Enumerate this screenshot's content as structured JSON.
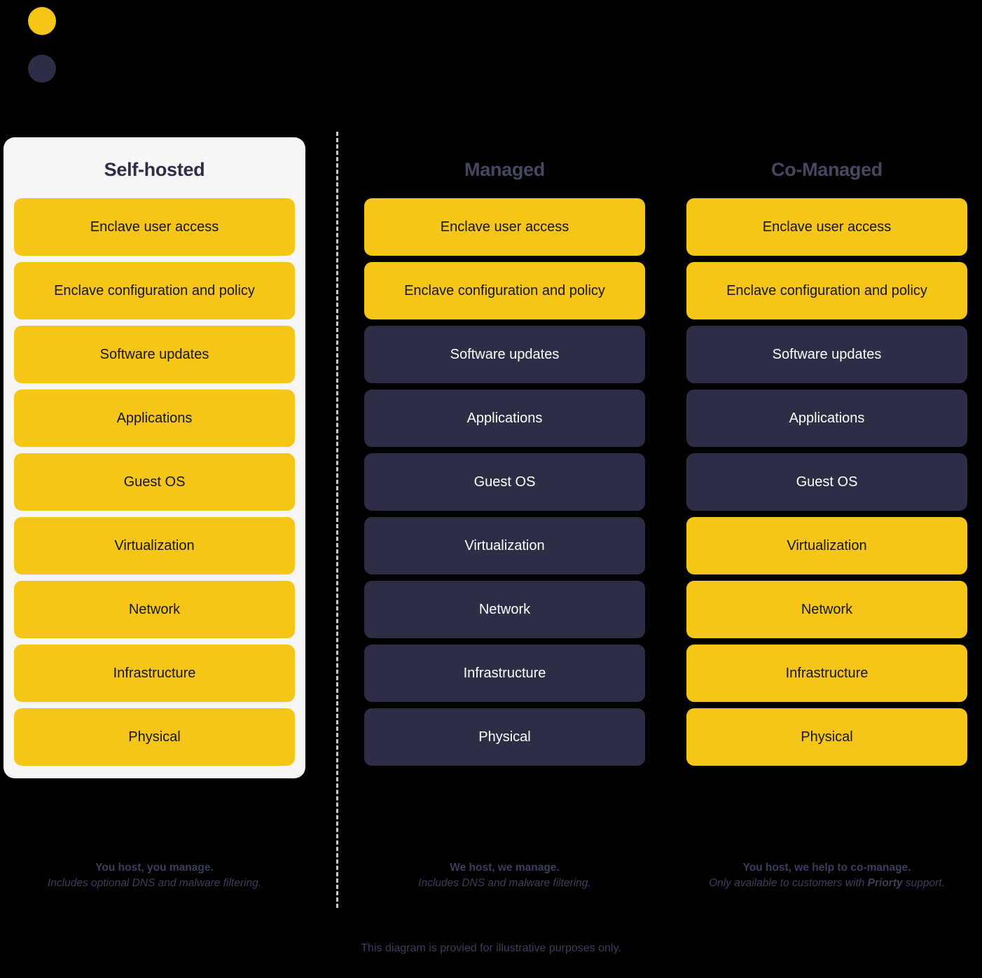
{
  "colors": {
    "yellow": "#F5C518",
    "dark_navy": "#2D2E45",
    "panel_background": "#F6F6F6",
    "page_background": "#000000",
    "divider": "#c9c9cf",
    "caption_text": "#3b3f5c"
  },
  "legend": {
    "items": [
      {
        "name": "yellow-dot",
        "color": "#F5C518",
        "label": ""
      },
      {
        "name": "dark-dot",
        "color": "#2D2E45",
        "label": ""
      }
    ]
  },
  "layer_names": [
    "Enclave user access",
    "Enclave configuration and policy",
    "Software updates",
    "Applications",
    "Guest OS",
    "Virtualization",
    "Network",
    "Infrastructure",
    "Physical"
  ],
  "columns": [
    {
      "id": "self-hosted",
      "title": "Self-hosted",
      "highlighted": true,
      "layers": [
        {
          "label": "Enclave user access",
          "tone": "yellow"
        },
        {
          "label": "Enclave configuration and policy",
          "tone": "yellow"
        },
        {
          "label": "Software updates",
          "tone": "yellow"
        },
        {
          "label": "Applications",
          "tone": "yellow"
        },
        {
          "label": "Guest OS",
          "tone": "yellow"
        },
        {
          "label": "Virtualization",
          "tone": "yellow"
        },
        {
          "label": "Network",
          "tone": "yellow"
        },
        {
          "label": "Infrastructure",
          "tone": "yellow"
        },
        {
          "label": "Physical",
          "tone": "yellow"
        }
      ],
      "caption": {
        "primary": "You host, you manage.",
        "secondary_prefix": "Includes optional DNS and malware filtering.",
        "secondary_strong": "",
        "secondary_suffix": ""
      }
    },
    {
      "id": "managed",
      "title": "Managed",
      "highlighted": false,
      "layers": [
        {
          "label": "Enclave user access",
          "tone": "yellow"
        },
        {
          "label": "Enclave configuration and policy",
          "tone": "yellow"
        },
        {
          "label": "Software updates",
          "tone": "dark"
        },
        {
          "label": "Applications",
          "tone": "dark"
        },
        {
          "label": "Guest OS",
          "tone": "dark"
        },
        {
          "label": "Virtualization",
          "tone": "dark"
        },
        {
          "label": "Network",
          "tone": "dark"
        },
        {
          "label": "Infrastructure",
          "tone": "dark"
        },
        {
          "label": "Physical",
          "tone": "dark"
        }
      ],
      "caption": {
        "primary": "We host, we manage.",
        "secondary_prefix": "Includes DNS and malware filtering.",
        "secondary_strong": "",
        "secondary_suffix": ""
      }
    },
    {
      "id": "co-managed",
      "title": "Co-Managed",
      "highlighted": false,
      "layers": [
        {
          "label": "Enclave user access",
          "tone": "yellow"
        },
        {
          "label": "Enclave configuration and policy",
          "tone": "yellow"
        },
        {
          "label": "Software updates",
          "tone": "dark"
        },
        {
          "label": "Applications",
          "tone": "dark"
        },
        {
          "label": "Guest OS",
          "tone": "dark"
        },
        {
          "label": "Virtualization",
          "tone": "yellow"
        },
        {
          "label": "Network",
          "tone": "yellow"
        },
        {
          "label": "Infrastructure",
          "tone": "yellow"
        },
        {
          "label": "Physical",
          "tone": "yellow"
        }
      ],
      "caption": {
        "primary": "You host, we help to co-manage.",
        "secondary_prefix": "Only available to customers with ",
        "secondary_strong": "Priorty",
        "secondary_suffix": " support."
      }
    }
  ],
  "disclaimer": "This diagram is provied for illustrative purposes only."
}
